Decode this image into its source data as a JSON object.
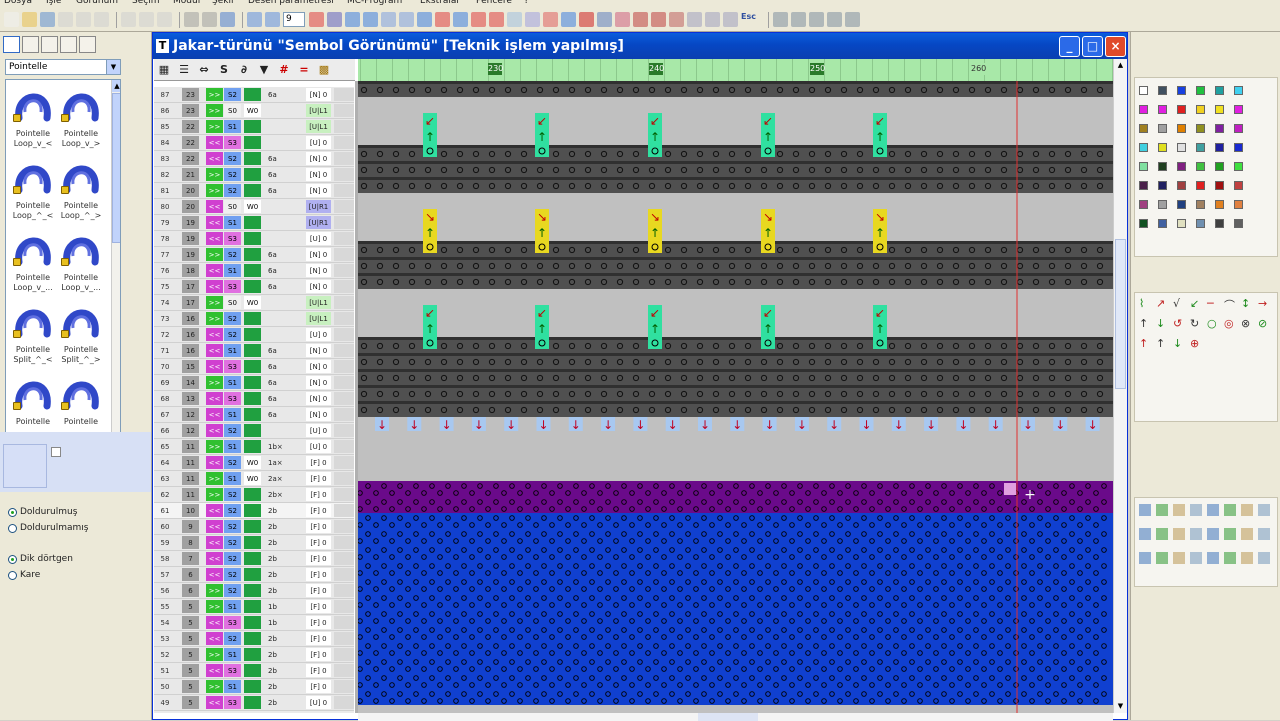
{
  "menu": [
    "Dosya",
    "İşle",
    "Görünüm",
    "Seçim",
    "Modül",
    "Şekil",
    "Desen parametresi",
    "MC-Program",
    "Ekstralar",
    "Pencere",
    "?"
  ],
  "toolbar": {
    "zoom_value": "9",
    "esc_label": "Esc"
  },
  "left_panel": {
    "category_select": "Pointelle",
    "tiles": [
      {
        "label1": "Pointelle",
        "label2": "Loop_v_<"
      },
      {
        "label1": "Pointelle",
        "label2": "Loop_v_>"
      },
      {
        "label1": "Pointelle",
        "label2": "Loop_^_<"
      },
      {
        "label1": "Pointelle",
        "label2": "Loop_^_>"
      },
      {
        "label1": "Pointelle",
        "label2": "Loop_v_..."
      },
      {
        "label1": "Pointelle",
        "label2": "Loop_v_..."
      },
      {
        "label1": "Pointelle",
        "label2": "Split_^_<"
      },
      {
        "label1": "Pointelle",
        "label2": "Split_^_>"
      },
      {
        "label1": "Pointelle",
        "label2": ""
      },
      {
        "label1": "Pointelle",
        "label2": ""
      }
    ],
    "fill_options": [
      {
        "label": "Doldurulmuş",
        "selected": true
      },
      {
        "label": "Doldurulmamış",
        "selected": false
      }
    ],
    "shape_options": [
      {
        "label": "Dik dörtgen",
        "selected": true
      },
      {
        "label": "Kare",
        "selected": false
      }
    ]
  },
  "window": {
    "title": "Jakar-türünü \"Sembol Görünümü\" [Teknik işlem yapılmış]"
  },
  "ruler": {
    "labels": [
      "230",
      "240",
      "250",
      "260"
    ]
  },
  "rows": [
    {
      "n": "87",
      "a": "23",
      "d": "S2",
      "e": "6a",
      "r": "[N] 0",
      "c": "g"
    },
    {
      "n": "86",
      "a": "23",
      "d": "S0",
      "w": "W0",
      "r": "[U|L1",
      "c": "s"
    },
    {
      "n": "85",
      "a": "22",
      "d": "S1",
      "r": "[U|L1",
      "c": "s"
    },
    {
      "n": "84",
      "a": "22",
      "d": "S3",
      "r": "[U] 0",
      "c": "p"
    },
    {
      "n": "83",
      "a": "22",
      "d": "S2",
      "e": "6a",
      "r": "[N] 0",
      "c": "p"
    },
    {
      "n": "82",
      "a": "21",
      "d": "S2",
      "e": "6a",
      "r": "[N] 0",
      "c": "g"
    },
    {
      "n": "81",
      "a": "20",
      "d": "S2",
      "e": "6a",
      "r": "[N] 0",
      "c": "g"
    },
    {
      "n": "80",
      "a": "20",
      "d": "S0",
      "w": "W0",
      "r": "[U|R1",
      "c": "b"
    },
    {
      "n": "79",
      "a": "19",
      "d": "S1",
      "r": "[U|R1",
      "c": "b"
    },
    {
      "n": "78",
      "a": "19",
      "d": "S3",
      "r": "[U] 0",
      "c": "p"
    },
    {
      "n": "77",
      "a": "19",
      "d": "S2",
      "e": "6a",
      "r": "[N] 0",
      "c": "g"
    },
    {
      "n": "76",
      "a": "18",
      "d": "S1",
      "e": "6a",
      "r": "[N] 0",
      "c": "p"
    },
    {
      "n": "75",
      "a": "17",
      "d": "S3",
      "e": "6a",
      "r": "[N] 0",
      "c": "p"
    },
    {
      "n": "74",
      "a": "17",
      "d": "S0",
      "w": "W0",
      "r": "[U|L1",
      "c": "s"
    },
    {
      "n": "73",
      "a": "16",
      "d": "S2",
      "r": "[U|L1",
      "c": "s"
    },
    {
      "n": "72",
      "a": "16",
      "d": "S2",
      "r": "[U] 0",
      "c": "p"
    },
    {
      "n": "71",
      "a": "16",
      "d": "S1",
      "e": "6a",
      "r": "[N] 0",
      "c": "p"
    },
    {
      "n": "70",
      "a": "15",
      "d": "S3",
      "e": "6a",
      "r": "[N] 0",
      "c": "p"
    },
    {
      "n": "69",
      "a": "14",
      "d": "S1",
      "e": "6a",
      "r": "[N] 0",
      "c": "g"
    },
    {
      "n": "68",
      "a": "13",
      "d": "S3",
      "e": "6a",
      "r": "[N] 0",
      "c": "p"
    },
    {
      "n": "67",
      "a": "12",
      "d": "S1",
      "e": "6a",
      "r": "[N] 0",
      "c": "p"
    },
    {
      "n": "66",
      "a": "12",
      "d": "S2",
      "r": "[U] 0",
      "c": "p"
    },
    {
      "n": "65",
      "a": "11",
      "d": "S1",
      "e": "1b×",
      "r": "[U] 0",
      "c": "g"
    },
    {
      "n": "64",
      "a": "11",
      "d": "S2",
      "w": "W0",
      "e": "1a×",
      "r": "[F] 0",
      "c": "p"
    },
    {
      "n": "63",
      "a": "11",
      "d": "S1",
      "w": "W0",
      "e": "2a×",
      "r": "[F] 0",
      "c": "g"
    },
    {
      "n": "62",
      "a": "11",
      "d": "S2",
      "e": "2b×",
      "r": "[F] 0",
      "c": "g"
    },
    {
      "n": "61",
      "a": "10",
      "d": "S2",
      "e": "2b",
      "r": "[F] 0",
      "c": "p"
    },
    {
      "n": "60",
      "a": "9",
      "d": "S2",
      "e": "2b",
      "r": "[F] 0",
      "c": "p"
    },
    {
      "n": "59",
      "a": "8",
      "d": "S2",
      "e": "2b",
      "r": "[F] 0",
      "c": "p"
    },
    {
      "n": "58",
      "a": "7",
      "d": "S2",
      "e": "2b",
      "r": "[F] 0",
      "c": "p"
    },
    {
      "n": "57",
      "a": "6",
      "d": "S2",
      "e": "2b",
      "r": "[F] 0",
      "c": "p"
    },
    {
      "n": "56",
      "a": "6",
      "d": "S2",
      "e": "2b",
      "r": "[F] 0",
      "c": "g"
    },
    {
      "n": "55",
      "a": "5",
      "d": "S1",
      "e": "1b",
      "r": "[F] 0",
      "c": "g"
    },
    {
      "n": "54",
      "a": "5",
      "d": "S3",
      "e": "1b",
      "r": "[F] 0",
      "c": "p"
    },
    {
      "n": "53",
      "a": "5",
      "d": "S2",
      "e": "2b",
      "r": "[F] 0",
      "c": "p"
    },
    {
      "n": "52",
      "a": "5",
      "d": "S1",
      "e": "2b",
      "r": "[F] 0",
      "c": "g"
    },
    {
      "n": "51",
      "a": "5",
      "d": "S3",
      "e": "2b",
      "r": "[F] 0",
      "c": "p"
    },
    {
      "n": "50",
      "a": "5",
      "d": "S1",
      "e": "2b",
      "r": "[F] 0",
      "c": "g"
    },
    {
      "n": "49",
      "a": "5",
      "d": "S3",
      "e": "2b",
      "r": "[U] 0",
      "c": "p"
    }
  ],
  "colors": {
    "title_blue": "#0a5ddc",
    "ruler_green": "#a8e8a8",
    "knit_blue": "#1040d0",
    "knit_purple": "#6a0a8a",
    "transfer_green": "#30e0a0",
    "transfer_yellow": "#e8d820",
    "stitch_gray": "#505050"
  }
}
